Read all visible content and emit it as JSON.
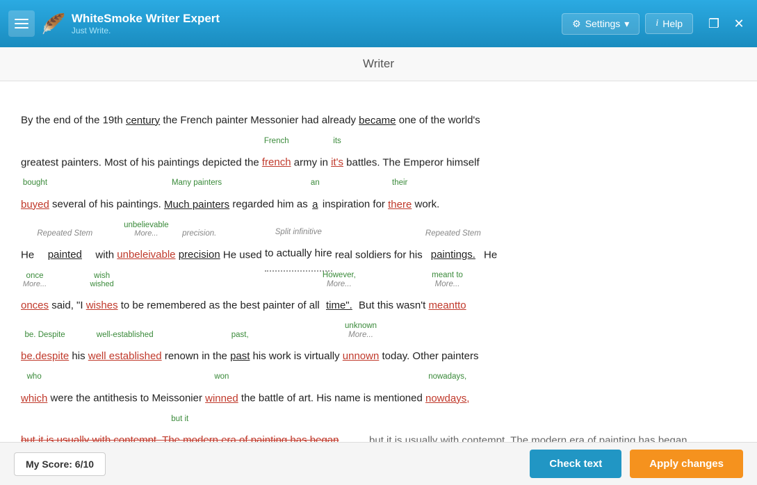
{
  "titlebar": {
    "menu_icon": "≡",
    "logo_title": "WhiteSmoke Writer Expert",
    "logo_sub": "Just Write.",
    "settings_label": "Settings",
    "help_label": "Help",
    "copy_icon": "❐",
    "close_icon": "✕"
  },
  "page": {
    "title": "Writer"
  },
  "bottom_bar": {
    "score_label": "My Score: 6/10",
    "check_text": "Check text",
    "apply_changes": "Apply changes"
  }
}
